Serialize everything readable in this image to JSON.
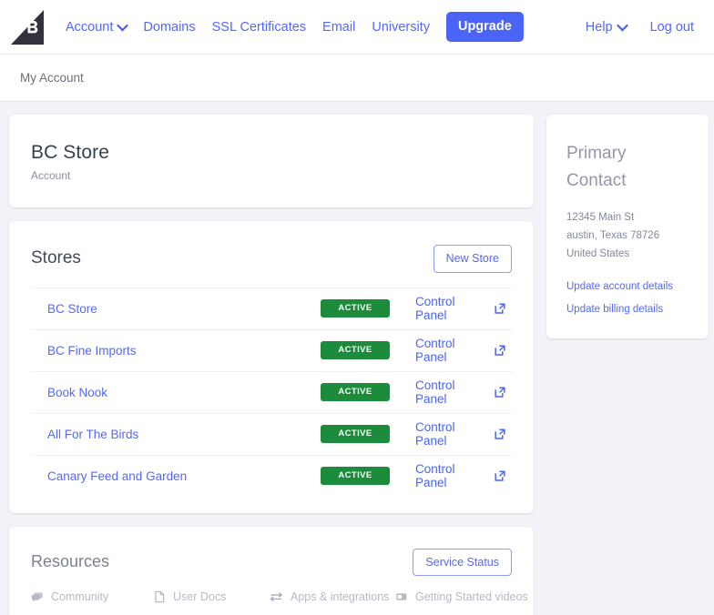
{
  "nav": {
    "logo_icon": "bigcommerce-b-logo",
    "links": [
      {
        "label": "Account",
        "has_caret": true
      },
      {
        "label": "Domains",
        "has_caret": false
      },
      {
        "label": "SSL Certificates",
        "has_caret": false
      },
      {
        "label": "Email",
        "has_caret": false
      },
      {
        "label": "University",
        "has_caret": false
      }
    ],
    "upgrade_label": "Upgrade",
    "help_label": "Help",
    "logout_label": "Log out",
    "caret_icon": "chevron-down-icon",
    "accent_color": "#5568f7",
    "upgrade_bg": "#4a64f5"
  },
  "breadcrumb": {
    "label": "My Account"
  },
  "account_card": {
    "title": "BC Store",
    "subtitle": "Account"
  },
  "stores_card": {
    "title": "Stores",
    "new_store_label": "New Store",
    "control_panel_label": "Control Panel",
    "external_link_icon": "external-link-icon",
    "badge_color": "#1c8b3b",
    "rows": [
      {
        "name": "BC Store",
        "status": "ACTIVE"
      },
      {
        "name": "BC Fine Imports",
        "status": "ACTIVE"
      },
      {
        "name": "Book Nook",
        "status": "ACTIVE"
      },
      {
        "name": "All For The Birds",
        "status": "ACTIVE"
      },
      {
        "name": "Canary Feed and Garden",
        "status": "ACTIVE"
      }
    ]
  },
  "resources_card": {
    "title": "Resources",
    "service_status_label": "Service Status",
    "links": [
      {
        "label": "Community",
        "icon": "chat-bubbles-icon"
      },
      {
        "label": "User Docs",
        "icon": "document-icon"
      },
      {
        "label": "Apps & integrations",
        "icon": "exchange-arrows-icon"
      },
      {
        "label": "Getting Started videos",
        "icon": "video-icon"
      }
    ]
  },
  "primary_contact": {
    "title_line1": "Primary",
    "title_line2": "Contact",
    "address_line1": "12345 Main St",
    "address_line2": "austin, Texas 78726",
    "address_line3": "United States",
    "update_account_label": "Update account details",
    "update_billing_label": "Update billing details"
  }
}
